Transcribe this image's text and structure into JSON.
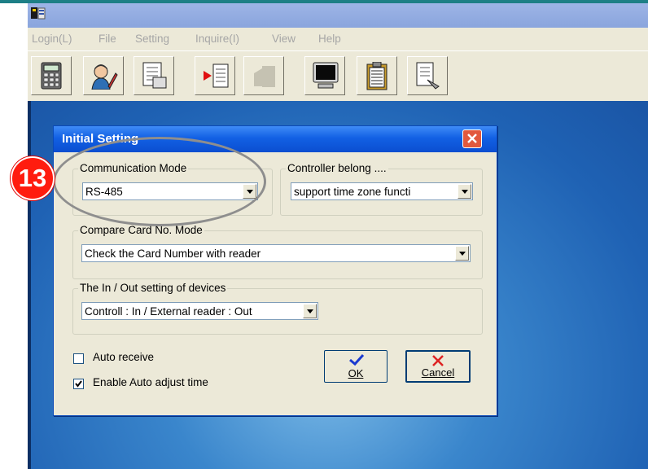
{
  "menu": [
    "Login(L)",
    "File",
    "Setting",
    "Inquire(I)",
    "View",
    "Help"
  ],
  "toolbar": {
    "buttons": [
      "calculator-icon",
      "user-edit-icon",
      "document-icon",
      "import-icon",
      "disabled-export-icon",
      "monitor-icon",
      "clipboard-icon",
      "report-icon"
    ]
  },
  "dialog": {
    "title": "Initial Setting",
    "comm_mode": {
      "label": "Communication Mode",
      "value": "RS-485"
    },
    "controller": {
      "label": "Controller belong ....",
      "value": "support time zone functi"
    },
    "compare": {
      "label": "Compare Card No.  Mode",
      "value": "Check the Card Number with reader"
    },
    "inout": {
      "label": "The In / Out setting of devices",
      "value": "Controll : In / External reader : Out"
    },
    "auto_receive": {
      "label": "Auto receive",
      "checked": false
    },
    "auto_adjust": {
      "label": "Enable Auto adjust time",
      "checked": true
    },
    "ok_label": "OK",
    "cancel_label": "Cancel"
  },
  "annotation": {
    "number": "13"
  },
  "colors": {
    "accent_badge": "#ff1c0f",
    "titlebar": "#0b4ed0",
    "desktop": "#3a86cc"
  }
}
